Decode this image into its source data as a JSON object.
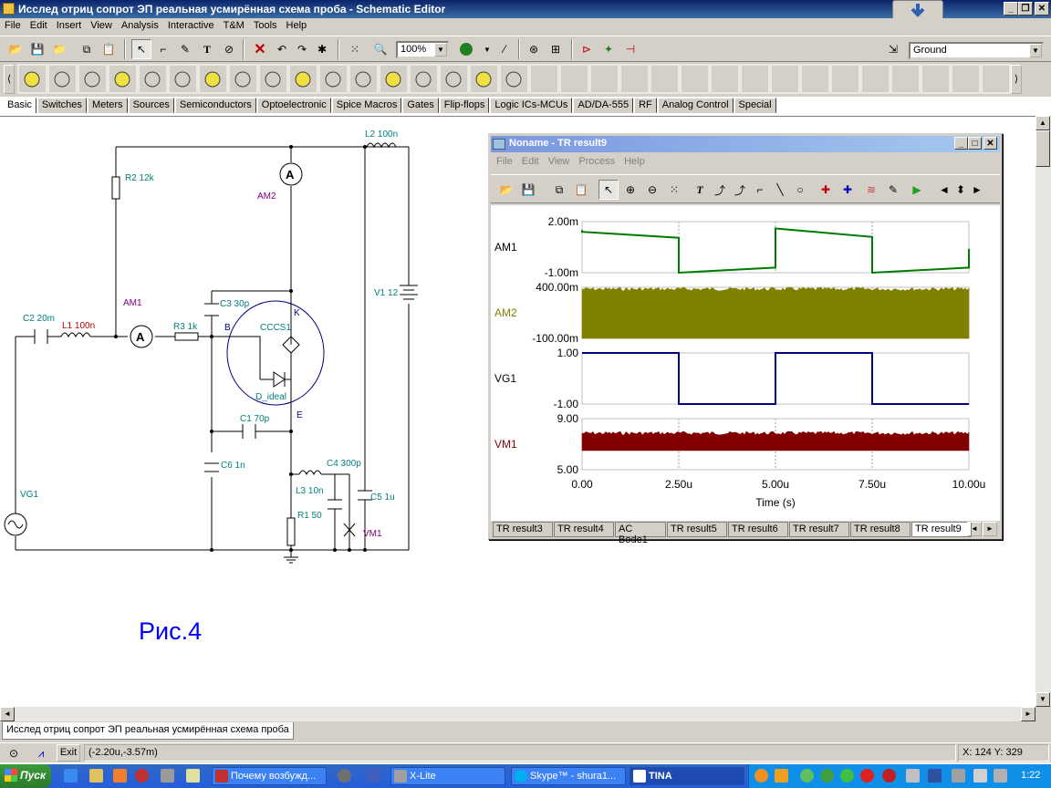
{
  "window": {
    "title": "Исслед отриц сопрот ЭП реальная усмирённая схема проба - Schematic Editor"
  },
  "menu": [
    "File",
    "Edit",
    "Insert",
    "View",
    "Analysis",
    "Interactive",
    "T&M",
    "Tools",
    "Help"
  ],
  "toolbar": {
    "zoom": "100%",
    "ground_select": "Ground"
  },
  "tabs": [
    "Basic",
    "Switches",
    "Meters",
    "Sources",
    "Semiconductors",
    "Optoelectronic",
    "Spice Macros",
    "Gates",
    "Flip-flops",
    "Logic ICs-MCUs",
    "AD/DA-555",
    "RF",
    "Analog Control",
    "Special"
  ],
  "schematic": {
    "labels": {
      "l2": "L2 100n",
      "r2": "R2 12k",
      "am2": "AM2",
      "am1": "AM1",
      "c3": "C3 30p",
      "v1": "V1 12",
      "k": "K",
      "c2": "C2 20m",
      "l1": "L1 100n",
      "r3": "R3 1k",
      "b": "B",
      "cccs": "CCCS1",
      "dideal": "D_ideal",
      "e": "E",
      "c1": "C1 70p",
      "c6": "C6 1n",
      "c4": "C4 300p",
      "l3": "L3 10n",
      "c5": "C5 1u",
      "vg1": "VG1",
      "r1": "R1 50",
      "vm1": "VM1",
      "ris": "Рис.4",
      "plus": "+"
    }
  },
  "result_window": {
    "title": "Noname - TR result9",
    "menu": [
      "File",
      "Edit",
      "View",
      "Process",
      "Help"
    ],
    "xlabel": "Time (s)",
    "xticks": [
      "0.00",
      "2.50u",
      "5.00u",
      "7.50u",
      "10.00u"
    ],
    "tabs": [
      "TR result3",
      "TR result4",
      "AC Bode1",
      "TR result5",
      "TR result6",
      "TR result7",
      "TR result8",
      "TR result9"
    ],
    "active_tab": "TR result9"
  },
  "chart_data": [
    {
      "type": "line",
      "series": [
        {
          "name": "AM1",
          "x": [
            0,
            0.0001,
            2.5,
            2.5001,
            5,
            5.0001,
            7.5,
            7.5001,
            10,
            10.0001
          ],
          "y": [
            1.5,
            1.4,
            1.05,
            -1.0,
            -0.7,
            1.6,
            1.1,
            -1.0,
            -0.7,
            0.4
          ]
        }
      ],
      "ylim": [
        -1.0,
        2.0
      ],
      "yticks": [
        "2.00m",
        "-1.00m"
      ],
      "color": "#007a00"
    },
    {
      "type": "area",
      "series": [
        {
          "name": "AM2",
          "note": "dense oscillation band",
          "y_range": [
            -100,
            400
          ]
        }
      ],
      "ylim": [
        -100,
        400
      ],
      "yticks": [
        "400.00m",
        "-100.00m"
      ],
      "color": "#808000"
    },
    {
      "type": "line",
      "series": [
        {
          "name": "VG1",
          "x": [
            0,
            2.5,
            2.5001,
            5,
            5.0001,
            7.5,
            7.5001,
            10
          ],
          "y": [
            1,
            1,
            -1,
            -1,
            1,
            1,
            -1,
            -1
          ]
        }
      ],
      "ylim": [
        -1.0,
        1.0
      ],
      "yticks": [
        "1.00",
        "-1.00"
      ],
      "color": "#000080"
    },
    {
      "type": "area",
      "series": [
        {
          "name": "VM1",
          "note": "dense oscillation band",
          "y_range": [
            6.5,
            8
          ]
        }
      ],
      "ylim": [
        5.0,
        9.0
      ],
      "yticks": [
        "9.00",
        "5.00"
      ],
      "color": "#800000"
    }
  ],
  "doc_tab": "Исслед отриц сопрот ЭП реальная усмирённая схема проба",
  "status": {
    "exit": "Exit",
    "coords": "(-2.20u,-3.57m)",
    "xy": "X: 124  Y: 329"
  },
  "taskbar": {
    "start": "Пуск",
    "tasks": [
      "Почему возбужд...",
      "X-Lite",
      "Skype™ - shura1...",
      "TINA"
    ],
    "clock": "1:22"
  }
}
